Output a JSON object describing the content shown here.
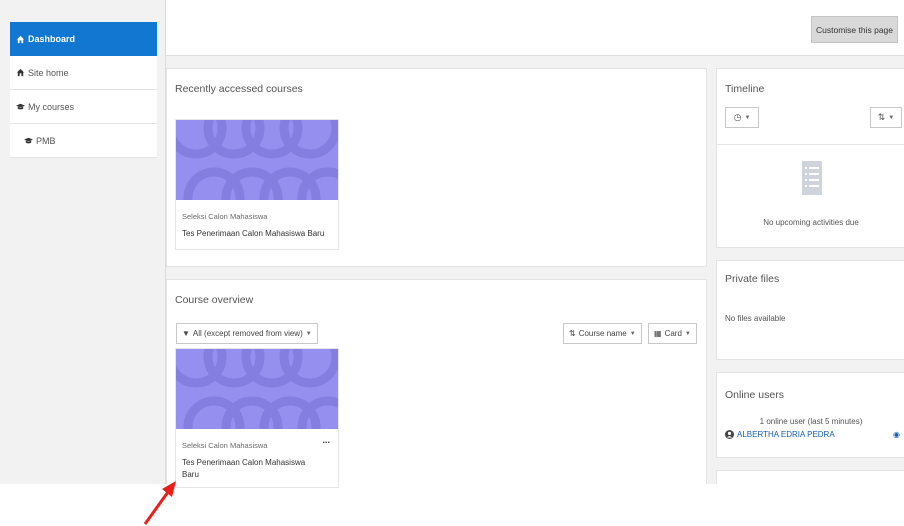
{
  "sidebar": {
    "items": [
      {
        "label": "Dashboard"
      },
      {
        "label": "Site home"
      },
      {
        "label": "My courses"
      },
      {
        "label": "PMB"
      }
    ]
  },
  "header": {
    "customise_label": "Customise this page"
  },
  "recent": {
    "title": "Recently accessed courses",
    "course": {
      "category": "Seleksi Calon Mahasiswa",
      "name": "Tes Penerimaan Calon Mahasiswa Baru"
    }
  },
  "overview": {
    "title": "Course overview",
    "filter_label": "All (except removed from view)",
    "sort_label": "Course name",
    "view_label": "Card",
    "course": {
      "category": "Seleksi Calon Mahasiswa",
      "name_line1": "Tes Penerimaan Calon Mahasiswa",
      "name_line2": "Baru",
      "menu": "..."
    }
  },
  "timeline": {
    "title": "Timeline",
    "empty_text": "No upcoming activities due"
  },
  "private_files": {
    "title": "Private files",
    "empty_text": "No files available"
  },
  "online_users": {
    "title": "Online users",
    "summary": "1 online user (last 5 minutes)",
    "user_name": "ALBERTHA EDRIA PEDRA"
  },
  "colors": {
    "primary": "#1177d1",
    "course_image": "#9590f0",
    "annotation_arrow": "#e8201b"
  }
}
